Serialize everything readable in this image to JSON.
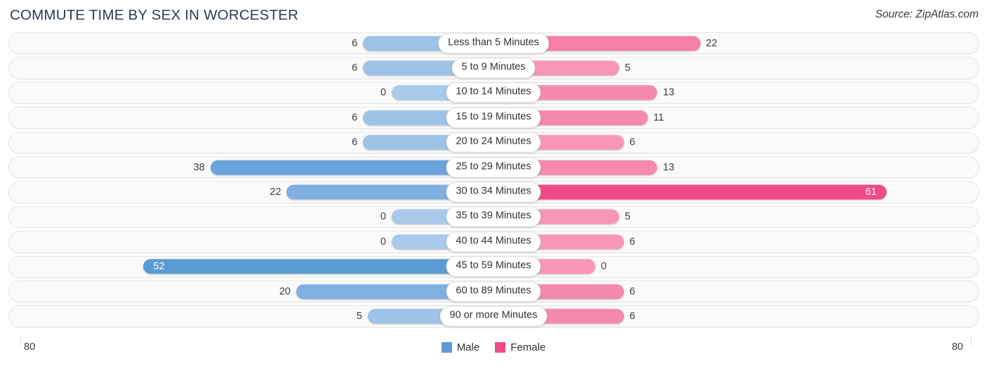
{
  "header": {
    "title": "COMMUTE TIME BY SEX IN WORCESTER",
    "source": "Source: ZipAtlas.com"
  },
  "legend": {
    "male_label": "Male",
    "female_label": "Female",
    "male_color": "#5b9bd5",
    "female_color": "#ef4b87"
  },
  "axis": {
    "left_tick": "80",
    "right_tick": "80",
    "max": 80
  },
  "colors": {
    "male_light": "#9dc3e6",
    "male_mid": "#7fb0e0",
    "male_strong": "#5b9bd5",
    "female_light": "#f896b8",
    "female_mid": "#f47fa8",
    "female_strong": "#ef4b87",
    "track_bg": "#fafafa",
    "track_border": "#e6e6e6"
  },
  "chart_data": {
    "type": "bar",
    "subtype": "diverging-bidirectional",
    "title": "COMMUTE TIME BY SEX IN WORCESTER",
    "xlabel": "",
    "ylabel": "",
    "xlim": [
      80,
      80
    ],
    "grid": false,
    "legend_position": "bottom-center",
    "categories": [
      "Less than 5 Minutes",
      "5 to 9 Minutes",
      "10 to 14 Minutes",
      "15 to 19 Minutes",
      "20 to 24 Minutes",
      "25 to 29 Minutes",
      "30 to 34 Minutes",
      "35 to 39 Minutes",
      "40 to 44 Minutes",
      "45 to 59 Minutes",
      "60 to 89 Minutes",
      "90 or more Minutes"
    ],
    "series": [
      {
        "name": "Male",
        "values": [
          6,
          6,
          0,
          6,
          6,
          38,
          22,
          0,
          0,
          52,
          20,
          5
        ]
      },
      {
        "name": "Female",
        "values": [
          22,
          5,
          13,
          11,
          6,
          13,
          61,
          5,
          6,
          0,
          6,
          6
        ]
      }
    ]
  },
  "rows": [
    {
      "label": "Less than 5 Minutes",
      "male": "6",
      "female": "22",
      "male_value": 6,
      "female_value": 22,
      "male_inside": false,
      "female_inside": false,
      "male_color": "#9dc3e6",
      "female_color": "#f47fa8"
    },
    {
      "label": "5 to 9 Minutes",
      "male": "6",
      "female": "5",
      "male_value": 6,
      "female_value": 5,
      "male_inside": false,
      "female_inside": false,
      "male_color": "#9dc3e6",
      "female_color": "#f896b8"
    },
    {
      "label": "10 to 14 Minutes",
      "male": "0",
      "female": "13",
      "male_value": 0,
      "female_value": 13,
      "male_inside": false,
      "female_inside": false,
      "male_color": "#a9caea",
      "female_color": "#f589ae"
    },
    {
      "label": "15 to 19 Minutes",
      "male": "6",
      "female": "11",
      "male_value": 6,
      "female_value": 11,
      "male_inside": false,
      "female_inside": false,
      "male_color": "#9dc3e6",
      "female_color": "#f589ae"
    },
    {
      "label": "20 to 24 Minutes",
      "male": "6",
      "female": "6",
      "male_value": 6,
      "female_value": 6,
      "male_inside": false,
      "female_inside": false,
      "male_color": "#9dc3e6",
      "female_color": "#f896b8"
    },
    {
      "label": "25 to 29 Minutes",
      "male": "38",
      "female": "13",
      "male_value": 38,
      "female_value": 13,
      "male_inside": false,
      "female_inside": false,
      "male_color": "#6ba3dc",
      "female_color": "#f589ae"
    },
    {
      "label": "30 to 34 Minutes",
      "male": "22",
      "female": "61",
      "male_value": 22,
      "female_value": 61,
      "male_inside": false,
      "female_inside": true,
      "male_color": "#7fb0e0",
      "female_color": "#ef4b87"
    },
    {
      "label": "35 to 39 Minutes",
      "male": "0",
      "female": "5",
      "male_value": 0,
      "female_value": 5,
      "male_inside": false,
      "female_inside": false,
      "male_color": "#a9caea",
      "female_color": "#f896b8"
    },
    {
      "label": "40 to 44 Minutes",
      "male": "0",
      "female": "6",
      "male_value": 0,
      "female_value": 6,
      "male_inside": false,
      "female_inside": false,
      "male_color": "#a9caea",
      "female_color": "#f896b8"
    },
    {
      "label": "45 to 59 Minutes",
      "male": "52",
      "female": "0",
      "male_value": 52,
      "female_value": 0,
      "male_inside": true,
      "female_inside": false,
      "male_color": "#5b9bd5",
      "female_color": "#f896b8"
    },
    {
      "label": "60 to 89 Minutes",
      "male": "20",
      "female": "6",
      "male_value": 20,
      "female_value": 6,
      "male_inside": false,
      "female_inside": false,
      "male_color": "#7fb0e0",
      "female_color": "#f589ae"
    },
    {
      "label": "90 or more Minutes",
      "male": "5",
      "female": "6",
      "male_value": 5,
      "female_value": 6,
      "male_inside": false,
      "female_inside": false,
      "male_color": "#9dc3e6",
      "female_color": "#f589ae"
    }
  ]
}
